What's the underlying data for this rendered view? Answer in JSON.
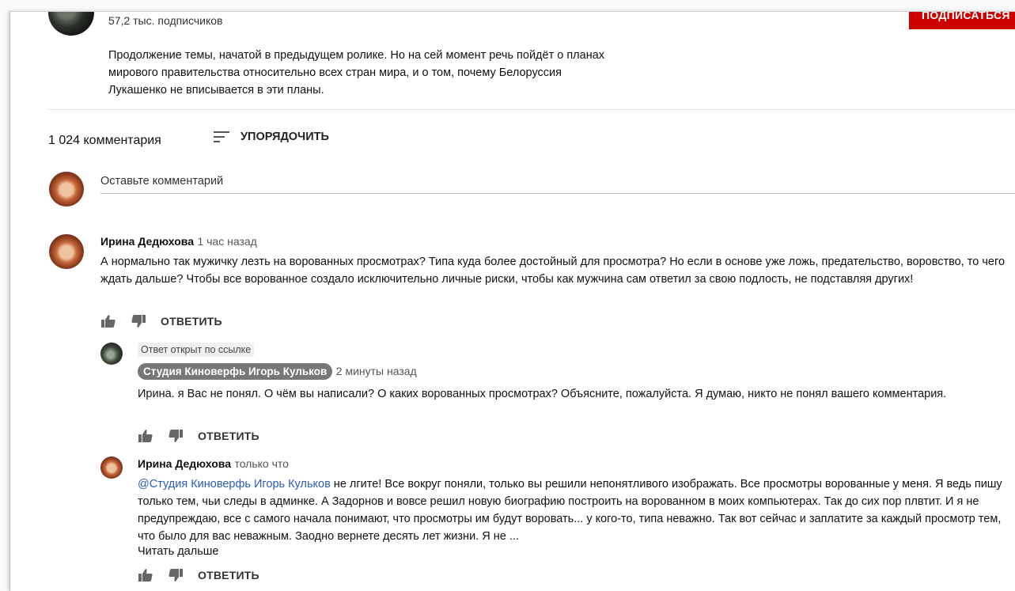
{
  "header": {
    "subscribers": "57,2 тыс. подписчиков",
    "subscribe_label": "ПОДПИСАТЬСЯ",
    "description": "Продолжение темы, начатой в предыдущем ролике. Но на сей момент речь пойдёт о планах\nмирового правительства относительно всех стран мира, и о том, почему Белоруссия\nЛукашенко не вписывается в эти планы."
  },
  "comments_section": {
    "count_label": "1 024 комментария",
    "sort_label": "УПОРЯДОЧИТЬ",
    "add_comment_placeholder": "Оставьте комментарий"
  },
  "comments": [
    {
      "author": "Ирина Дедюхова",
      "time": "1 час назад",
      "text": "А нормально так мужичку лезть на ворованных просмотрах? Типа куда более достойный для просмотра? Но если в основе уже ложь, предательство, воровство, то чего ждать дальше? Чтобы все ворованное создало исключительно личные риски, чтобы как мужчина сам ответил за свою подлость, не подставляя других!",
      "reply_label": "ОТВЕТИТЬ"
    }
  ],
  "replies": [
    {
      "badge": "Ответ открыт по ссылке",
      "author": "Студия Киноверфь Игорь Кульков",
      "time": "2 минуты назад",
      "text": "Ирина. я Вас не понял. О чём вы написали? О каких ворованных просмотрах? Объясните, пожалуйста. Я думаю, никто не понял вашего комментария.",
      "reply_label": "ОТВЕТИТЬ"
    },
    {
      "author": "Ирина Дедюхова",
      "time": "только что",
      "mention": "@Студия Киноверфь Игорь Кульков",
      "text": " не лгите! Все вокруг поняли, только вы решили непонятливого изображать. Все просмотры ворованные у меня. Я ведь пишу только тем, чьи следы в админке. А Задорнов и вовсе решил новую биографию построить на ворованном в моих компьютерах. Так до сих пор плвтит. И я не предупреждаю, все с самого начала понимают, что просмотры им будут воровать... у кого-то, типа неважно. Так вот сейчас и заплатите за каждый просмотр тем, что было для вас неважным. Заодно вернете десять лет жизни. Я не ...",
      "read_more": "Читать дальше",
      "reply_label": "ОТВЕТИТЬ"
    }
  ],
  "colors": {
    "subscribe_red": "#cc0000",
    "mention_blue": "#2a5db0",
    "chip_gray": "#777777"
  },
  "icons": [
    "like-icon",
    "dislike-icon",
    "sort-icon"
  ]
}
